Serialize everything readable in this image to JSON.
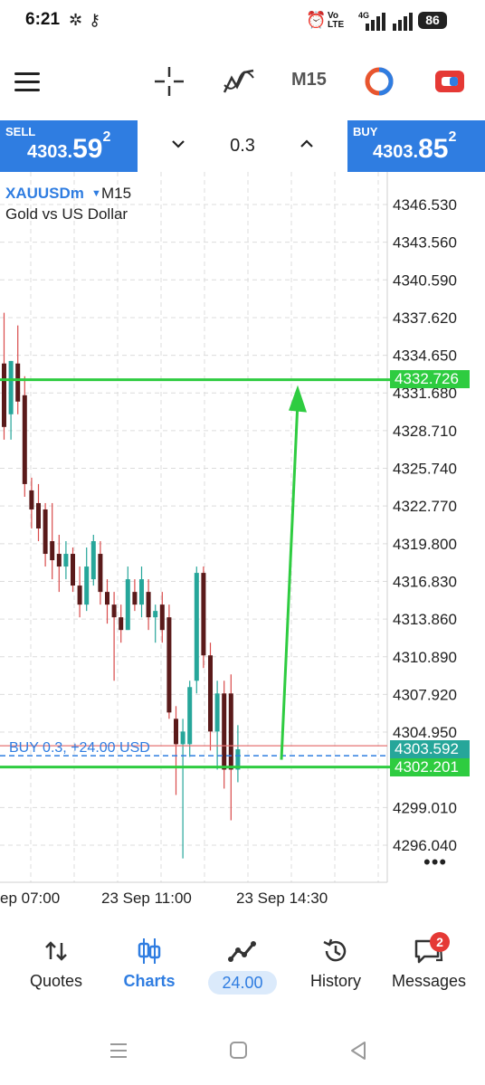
{
  "status_bar": {
    "time": "6:21",
    "battery": "86",
    "network": "4G"
  },
  "toolbar": {
    "timeframe": "M15",
    "icons": [
      "menu-icon",
      "crosshair-icon",
      "indicators-icon",
      "objects-icon",
      "trade-icon"
    ]
  },
  "trade_bar": {
    "sell_label": "SELL",
    "sell_price_small": "4303.",
    "sell_price_big": "59",
    "sell_price_sup": "2",
    "buy_label": "BUY",
    "buy_price_small": "4303.",
    "buy_price_big": "85",
    "buy_price_sup": "2",
    "volume": "0.3"
  },
  "chart": {
    "symbol": "XAUUSDm",
    "timeframe": "M15",
    "description": "Gold vs US Dollar",
    "position_label": "BUY 0.3,  +24.00 USD",
    "price_tags": {
      "target": "4332.726",
      "current": "4303.592",
      "entry": "4302.201"
    },
    "x_labels": [
      "ep 07:00",
      "23 Sep 11:00",
      "23 Sep 14:30"
    ]
  },
  "chart_data": {
    "type": "candlestick",
    "symbol": "XAUUSDm",
    "timeframe": "M15",
    "y_ticks": [
      "4346.530",
      "4343.560",
      "4340.590",
      "4337.620",
      "4334.650",
      "4331.680",
      "4328.710",
      "4325.740",
      "4322.770",
      "4319.800",
      "4316.830",
      "4313.860",
      "4310.890",
      "4307.920",
      "4304.950",
      "4299.010",
      "4296.040"
    ],
    "ylim": [
      4293.8,
      4348.5
    ],
    "horizontal_lines": [
      {
        "price": 4332.726,
        "color": "#2ecc40"
      },
      {
        "price": 4303.592,
        "color": "#26a69a"
      },
      {
        "price": 4302.201,
        "color": "#2ecc40"
      }
    ],
    "candles": [
      {
        "o": 4334.0,
        "h": 4338.0,
        "l": 4328.0,
        "c": 4329.0
      },
      {
        "o": 4330.0,
        "h": 4334.2,
        "l": 4328.0,
        "c": 4334.2
      },
      {
        "o": 4334.0,
        "h": 4337.0,
        "l": 4330.0,
        "c": 4331.0
      },
      {
        "o": 4331.5,
        "h": 4333.0,
        "l": 4323.5,
        "c": 4324.5
      },
      {
        "o": 4324.0,
        "h": 4325.0,
        "l": 4321.0,
        "c": 4322.5
      },
      {
        "o": 4323.0,
        "h": 4324.5,
        "l": 4320.0,
        "c": 4321.0
      },
      {
        "o": 4322.5,
        "h": 4323.0,
        "l": 4318.0,
        "c": 4319.0
      },
      {
        "o": 4320.0,
        "h": 4323.0,
        "l": 4317.0,
        "c": 4318.5
      },
      {
        "o": 4319.0,
        "h": 4320.5,
        "l": 4316.0,
        "c": 4318.0
      },
      {
        "o": 4318.0,
        "h": 4320.0,
        "l": 4317.0,
        "c": 4319.0
      },
      {
        "o": 4319.0,
        "h": 4319.5,
        "l": 4316.0,
        "c": 4316.5
      },
      {
        "o": 4316.5,
        "h": 4318.0,
        "l": 4314.0,
        "c": 4315.0
      },
      {
        "o": 4315.0,
        "h": 4319.5,
        "l": 4314.5,
        "c": 4318.0
      },
      {
        "o": 4317.0,
        "h": 4320.5,
        "l": 4316.5,
        "c": 4320.0
      },
      {
        "o": 4319.0,
        "h": 4320.0,
        "l": 4315.0,
        "c": 4316.0
      },
      {
        "o": 4316.0,
        "h": 4317.0,
        "l": 4313.5,
        "c": 4315.0
      },
      {
        "o": 4315.0,
        "h": 4316.0,
        "l": 4309.0,
        "c": 4314.0
      },
      {
        "o": 4314.0,
        "h": 4315.0,
        "l": 4312.0,
        "c": 4313.0
      },
      {
        "o": 4313.0,
        "h": 4318.0,
        "l": 4313.0,
        "c": 4317.0
      },
      {
        "o": 4316.0,
        "h": 4317.0,
        "l": 4314.5,
        "c": 4315.0
      },
      {
        "o": 4315.0,
        "h": 4318.0,
        "l": 4314.0,
        "c": 4317.0
      },
      {
        "o": 4316.0,
        "h": 4317.0,
        "l": 4313.0,
        "c": 4314.0
      },
      {
        "o": 4314.0,
        "h": 4315.0,
        "l": 4312.0,
        "c": 4314.5
      },
      {
        "o": 4315.0,
        "h": 4316.0,
        "l": 4312.0,
        "c": 4313.0
      },
      {
        "o": 4314.0,
        "h": 4315.0,
        "l": 4306.0,
        "c": 4306.5
      },
      {
        "o": 4306.0,
        "h": 4307.0,
        "l": 4300.0,
        "c": 4304.0
      },
      {
        "o": 4304.0,
        "h": 4306.0,
        "l": 4295.0,
        "c": 4305.0
      },
      {
        "o": 4304.0,
        "h": 4309.0,
        "l": 4303.0,
        "c": 4308.5
      },
      {
        "o": 4309.0,
        "h": 4318.0,
        "l": 4308.0,
        "c": 4317.5
      },
      {
        "o": 4317.5,
        "h": 4318.0,
        "l": 4310.0,
        "c": 4311.0
      },
      {
        "o": 4311.0,
        "h": 4312.0,
        "l": 4303.5,
        "c": 4305.0
      },
      {
        "o": 4305.0,
        "h": 4309.0,
        "l": 4302.0,
        "c": 4308.0
      },
      {
        "o": 4308.0,
        "h": 4309.0,
        "l": 4300.5,
        "c": 4302.0
      },
      {
        "o": 4308.0,
        "h": 4309.5,
        "l": 4298.0,
        "c": 4302.0
      },
      {
        "o": 4302.0,
        "h": 4305.5,
        "l": 4301.0,
        "c": 4303.6
      }
    ]
  },
  "bottom_nav": {
    "items": [
      {
        "label": "Quotes",
        "icon": "quotes-icon"
      },
      {
        "label": "Charts",
        "icon": "charts-icon"
      },
      {
        "label": "24.00",
        "icon": "trade-icon"
      },
      {
        "label": "History",
        "icon": "history-icon"
      },
      {
        "label": "Messages",
        "icon": "messages-icon"
      }
    ],
    "messages_badge": "2"
  }
}
